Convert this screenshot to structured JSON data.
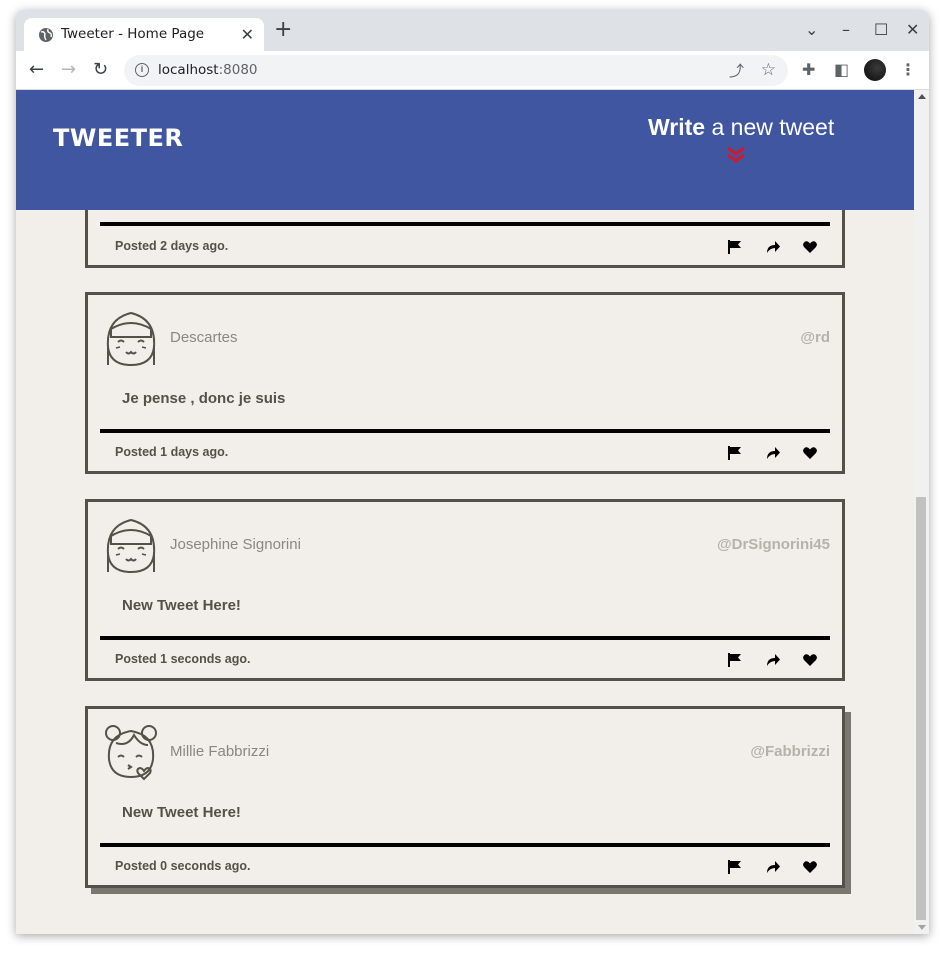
{
  "browser": {
    "tab_title": "Tweeter - Home Page",
    "tab_close": "✕",
    "new_tab": "+",
    "url_host": "localhost",
    "url_port": ":8080",
    "info_glyph": "i"
  },
  "header": {
    "logo": "TWEETER",
    "compose_bold": "Write",
    "compose_rest": " a new tweet",
    "chevrons": "»"
  },
  "tweets": [
    {
      "name": "",
      "handle": "",
      "content": "",
      "posted": "Posted 2 days ago."
    },
    {
      "name": "Descartes",
      "handle": "@rd",
      "content": "Je pense , donc je suis",
      "posted": "Posted 1 days ago."
    },
    {
      "name": "Josephine Signorini",
      "handle": "@DrSignorini45",
      "content": "New Tweet Here!",
      "posted": "Posted 1 seconds ago."
    },
    {
      "name": "Millie Fabbrizzi",
      "handle": "@Fabbrizzi",
      "content": "New Tweet Here!",
      "posted": "Posted 0 seconds ago."
    }
  ],
  "icons": {
    "tab_favicon": "globe-icon",
    "actions": [
      "flag-icon",
      "retweet-icon",
      "heart-icon"
    ]
  },
  "colors": {
    "header_bg": "#4056a1",
    "accent_chevron": "#d01a2c",
    "page_bg": "#f2efeb",
    "border": "#545149"
  }
}
